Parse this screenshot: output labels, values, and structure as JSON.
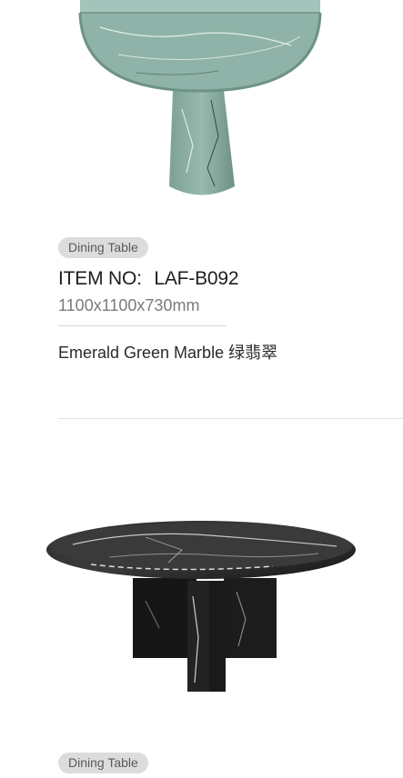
{
  "products": [
    {
      "category": "Dining Table",
      "item_no_label": "ITEM NO:",
      "item_no": "LAF-B092",
      "dimensions": "1100x1100x730mm",
      "material": "Emerald Green Marble 绿翡翠",
      "image": "emerald-green-marble-table-image",
      "colors": {
        "marble": "#8fb3a8",
        "vein": "#e8f0ec"
      }
    },
    {
      "category": "Dining Table",
      "image": "black-marble-round-table-image",
      "colors": {
        "marble": "#1c1c1c",
        "vein": "#d8d8d8"
      }
    }
  ]
}
